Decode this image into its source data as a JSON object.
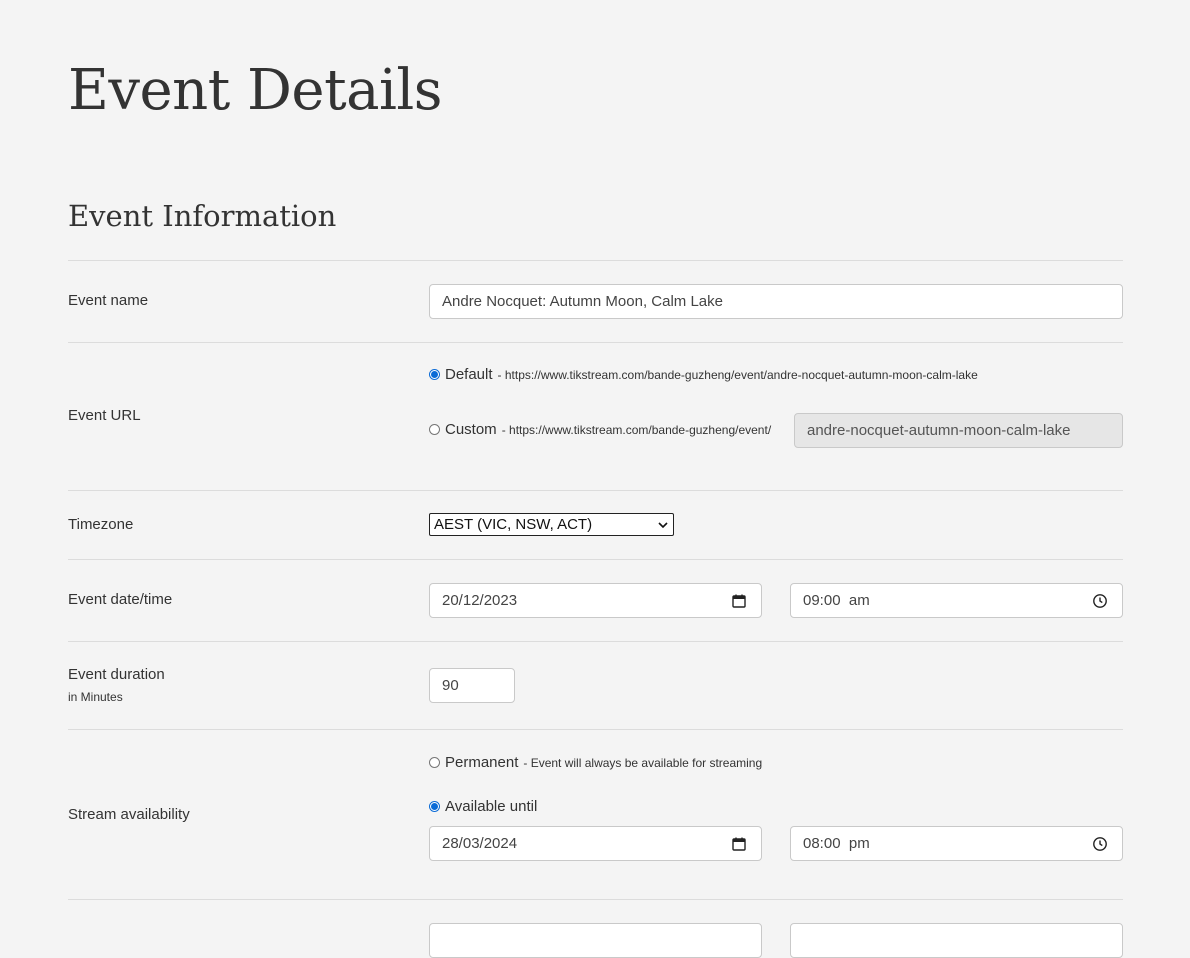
{
  "page": {
    "title": "Event Details"
  },
  "section": {
    "title": "Event Information"
  },
  "event_name": {
    "label": "Event name",
    "value": "Andre Nocquet: Autumn Moon, Calm Lake"
  },
  "event_url": {
    "label": "Event URL",
    "default_label": "Default",
    "default_desc": "- https://www.tikstream.com/bande-guzheng/event/andre-nocquet-autumn-moon-calm-lake",
    "default_selected": true,
    "custom_label": "Custom",
    "custom_desc": "- https://www.tikstream.com/bande-guzheng/event/",
    "custom_slug": "andre-nocquet-autumn-moon-calm-lake"
  },
  "timezone": {
    "label": "Timezone",
    "selected": "AEST (VIC, NSW, ACT)"
  },
  "event_datetime": {
    "label": "Event date/time",
    "date": "20/12/2023",
    "time": "09:00  am"
  },
  "event_duration": {
    "label": "Event duration",
    "sublabel": "in Minutes",
    "value": "90"
  },
  "stream_availability": {
    "label": "Stream availability",
    "permanent_label": "Permanent",
    "permanent_desc": "- Event will always be available for streaming",
    "until_label": "Available until",
    "selected": "Available until",
    "date": "28/03/2024",
    "time": "08:00  pm"
  },
  "icons": {
    "date": "calendar-icon",
    "time": "clock-icon",
    "select": "chevron-down-icon"
  },
  "colors": {
    "background": "#f4f4f4",
    "radio_accent": "#0b6bd6",
    "divider": "#dcdcdc"
  }
}
